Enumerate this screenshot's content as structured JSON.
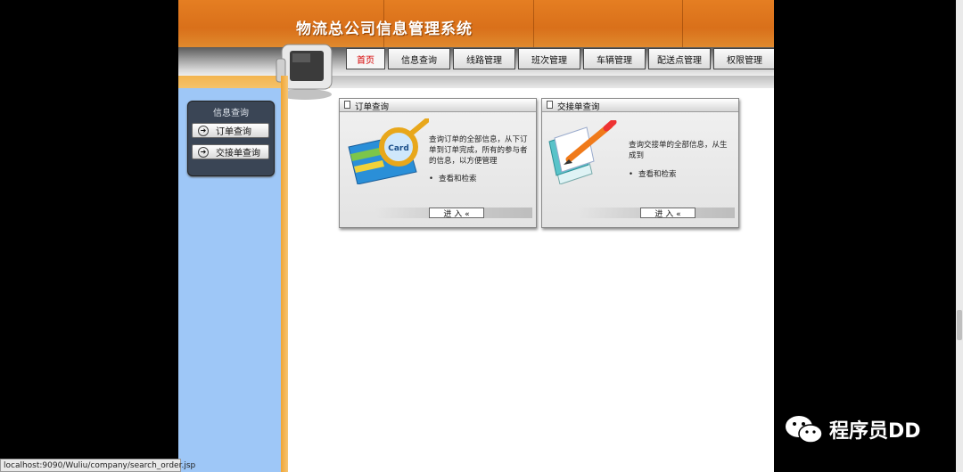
{
  "app": {
    "title": "物流总公司信息管理系统"
  },
  "nav": {
    "tabs": [
      {
        "label": "首页",
        "active": true
      },
      {
        "label": "信息查询",
        "active": false
      },
      {
        "label": "线路管理",
        "active": false
      },
      {
        "label": "班次管理",
        "active": false
      },
      {
        "label": "车辆管理",
        "active": false
      },
      {
        "label": "配送点管理",
        "active": false
      },
      {
        "label": "权限管理",
        "active": false
      }
    ]
  },
  "sidebar": {
    "title": "信息查询",
    "items": [
      {
        "label": "订单查询",
        "icon": "arrow-circle-icon"
      },
      {
        "label": "交接单查询",
        "icon": "arrow-circle-icon"
      }
    ]
  },
  "cards": [
    {
      "title": "订单查询",
      "description": "查询订单的全部信息，从下订单到订单完成，所有的参与者的信息，以方便管理",
      "bullet": "查看和检索",
      "enter_label": "进 入  «",
      "image_text": "Card"
    },
    {
      "title": "交接单查询",
      "description": "查询交接单的全部信息，从生成到",
      "bullet": "查看和检索",
      "enter_label": "进 入  «"
    }
  ],
  "status": {
    "url": "localhost:9090/Wuliu/company/search_order.jsp"
  },
  "watermark": {
    "text": "程序员DD"
  },
  "colors": {
    "header": "#e07b22",
    "sidebar": "#9ec7f7",
    "active_tab_text": "#d60000"
  }
}
